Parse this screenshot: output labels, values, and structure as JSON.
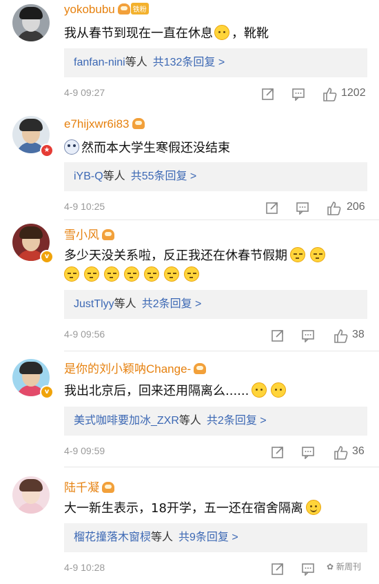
{
  "comments": [
    {
      "username": "yokobubu",
      "badge": "铁粉",
      "text": "我从春节到现在一直在休息",
      "emoji_after": "think",
      "text_tail": "，靴靴",
      "reply_who": "fanfan-nini",
      "reply_suffix": "等人",
      "reply_count": "共132条回复 >",
      "time": "4-9 09:27",
      "likes": "1202"
    },
    {
      "username": "e7hijxwr6i83",
      "text": "然而本大学生寒假还没结束",
      "emoji_before": "mask",
      "reply_who": "iYB-Q",
      "reply_suffix": "等人",
      "reply_count": "共55条回复 >",
      "time": "4-9 10:25",
      "likes": "206"
    },
    {
      "username": "雪小风",
      "text": "多少天没关系啦，反正我还在休春节假期",
      "reply_who": "JustTlyy",
      "reply_suffix": "等人",
      "reply_count": "共2条回复 >",
      "time": "4-9 09:56",
      "likes": "38"
    },
    {
      "username": "是你的刘小颖呐Change-",
      "text": "我出北京后，回来还用隔离么......",
      "reply_who": "美式咖啡要加冰_ZXR",
      "reply_suffix": "等人",
      "reply_count": "共2条回复 >",
      "time": "4-9 09:59",
      "likes": "36"
    },
    {
      "username": "陆千凝",
      "text": "大一新生表示，18开学，五一还在宿舍隔离",
      "reply_who": "榴花撞落木窗棂",
      "reply_suffix": "等人",
      "reply_count": "共9条回复 >",
      "time": "4-9 10:28",
      "likes": ""
    }
  ],
  "watermark": "新周刊",
  "icons": [
    "repost-icon",
    "comment-icon",
    "like-icon",
    "vip-crown-icon",
    "verified-badge-icon"
  ],
  "colors": {
    "username": "#e6810f",
    "link": "#3c68b4",
    "reply_bg": "#f2f2f2",
    "time": "#9a9a9a"
  }
}
